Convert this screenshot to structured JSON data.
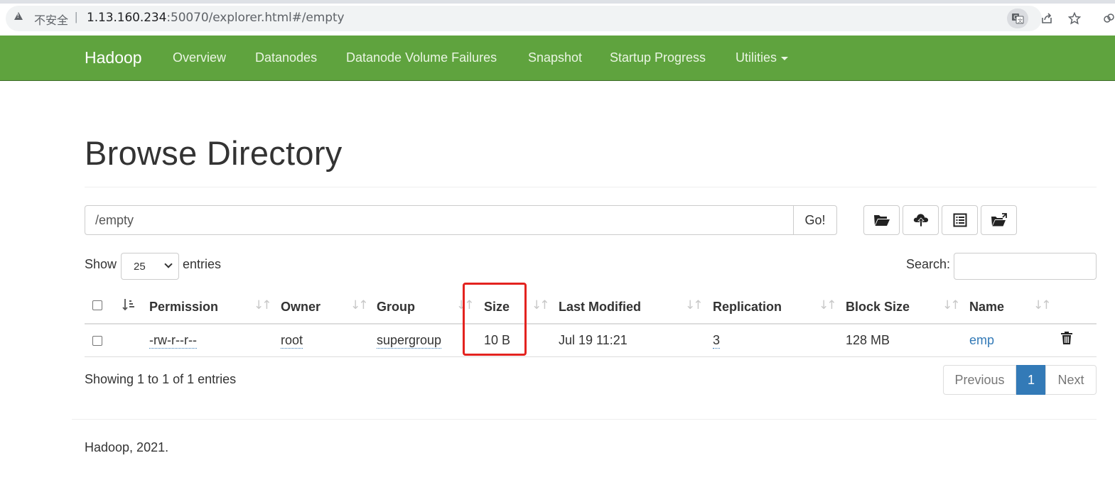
{
  "browser": {
    "security_text": "不安全",
    "separator": "|",
    "url_host": "1.13.160.234",
    "url_rest": ":50070/explorer.html#/empty"
  },
  "navbar": {
    "brand": "Hadoop",
    "items": [
      "Overview",
      "Datanodes",
      "Datanode Volume Failures",
      "Snapshot",
      "Startup Progress",
      "Utilities"
    ]
  },
  "page": {
    "title": "Browse Directory",
    "path_value": "/empty",
    "go_label": "Go!",
    "show_label": "Show",
    "entries_value": "25",
    "entries_label": "entries",
    "search_label": "Search:"
  },
  "table": {
    "headers": [
      "Permission",
      "Owner",
      "Group",
      "Size",
      "Last Modified",
      "Replication",
      "Block Size",
      "Name"
    ],
    "rows": [
      {
        "permission": "-rw-r--r--",
        "owner": "root",
        "group": "supergroup",
        "size": "10 B",
        "last_modified": "Jul 19 11:21",
        "replication": "3",
        "block_size": "128 MB",
        "name": "emp"
      }
    ]
  },
  "pagination": {
    "info": "Showing 1 to 1 of 1 entries",
    "previous": "Previous",
    "current": "1",
    "next": "Next"
  },
  "footer": {
    "text": "Hadoop, 2021."
  },
  "colors": {
    "navbar": "#5fa33e",
    "link": "#337ab7",
    "highlight": "#e3231f"
  },
  "icons": [
    "warning-icon",
    "translate-icon",
    "share-icon",
    "star-icon",
    "extension-icon",
    "folder-open-icon",
    "cloud-upload-icon",
    "list-alt-icon",
    "folder-move-icon",
    "trash-icon"
  ]
}
